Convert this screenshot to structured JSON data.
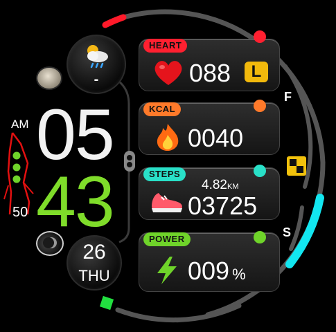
{
  "weather": {
    "value": "-",
    "icon": "cloud-sun-rain-icon"
  },
  "time": {
    "ampm": "AM",
    "hours": "05",
    "minutes": "43",
    "seconds_level": "50"
  },
  "date": {
    "day": "26",
    "weekday": "THU"
  },
  "cards": {
    "heart": {
      "label": "HEART",
      "value": "088",
      "badge": "L",
      "accent": "#ff2030"
    },
    "kcal": {
      "label": "KCAL",
      "value": "0040",
      "accent": "#ff7a2a"
    },
    "steps": {
      "label": "STEPS",
      "value": "03725",
      "distance": "4.82",
      "distance_unit": "KM",
      "accent": "#29e0c8"
    },
    "power": {
      "label": "POWER",
      "value": "009",
      "unit": "%",
      "accent": "#6fd42a"
    }
  },
  "side": {
    "top_letter": "F",
    "bottom_letter": "S"
  },
  "colors": {
    "red": "#ff1a2a",
    "cyan": "#12e6f0",
    "green": "#22e040",
    "yellow": "#f2c20c",
    "gray_ring": "#5a5a5a"
  }
}
